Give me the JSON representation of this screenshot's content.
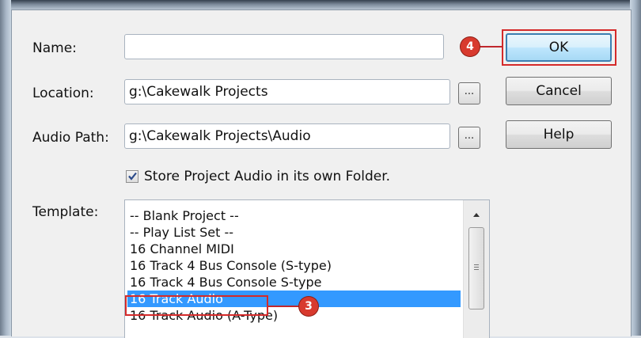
{
  "dialog": {
    "name_label": "Name:",
    "name_value": "",
    "location_label": "Location:",
    "location_value": "g:\\Cakewalk Projects",
    "audio_path_label": "Audio Path:",
    "audio_path_value": "g:\\Cakewalk Projects\\Audio",
    "browse_label": "...",
    "store_checkbox_label": "Store Project Audio in its own Folder.",
    "store_checkbox_checked": true,
    "template_label": "Template:"
  },
  "buttons": {
    "ok": "OK",
    "cancel": "Cancel",
    "help": "Help"
  },
  "template_list": {
    "items": [
      "-- Blank Project --",
      "-- Play List Set --",
      "16 Channel MIDI",
      "16 Track 4 Bus Console (S-type)",
      "16 Track 4 Bus Console S-type",
      "16 Track Audio",
      "16 Track Audio (A-Type)"
    ],
    "selected_index": 5
  },
  "callouts": {
    "ok_marker": "4",
    "template_marker": "3"
  },
  "colors": {
    "highlight": "#d42a2a",
    "callout": "#d83a2e",
    "selection": "#3399ff"
  }
}
